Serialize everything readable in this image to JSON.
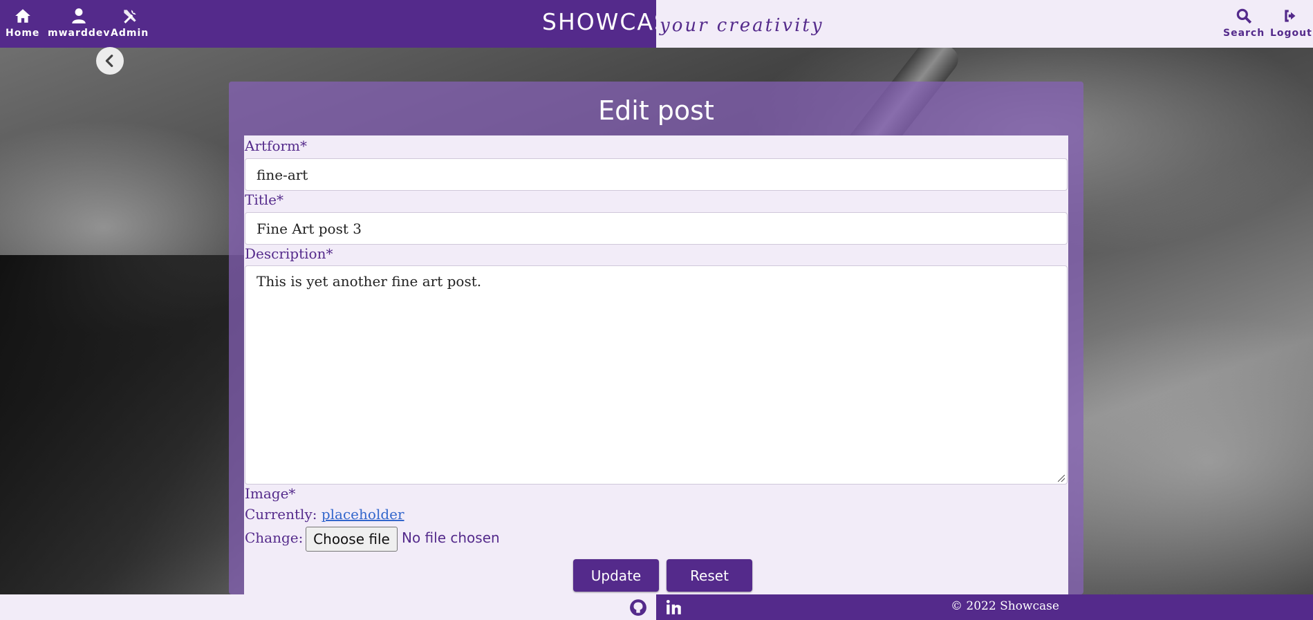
{
  "nav": {
    "left_items": [
      {
        "label": "Home",
        "icon": "home-icon"
      },
      {
        "label": "mwarddev",
        "icon": "user-icon"
      },
      {
        "label": "Admin",
        "icon": "tools-icon"
      }
    ],
    "brand": "SHOWCASE",
    "tagline": "your creativity",
    "right_items": [
      {
        "label": "Search",
        "icon": "search-icon"
      },
      {
        "label": "Logout",
        "icon": "logout-icon"
      }
    ]
  },
  "page": {
    "title": "Edit post",
    "back_icon": "chevron-left-icon"
  },
  "form": {
    "artform_label": "Artform*",
    "artform_value": "fine-art",
    "title_label": "Title*",
    "title_value": "Fine Art post 3",
    "description_label": "Description*",
    "description_value": "This is yet another fine art post.",
    "image_label": "Image*",
    "currently_label": "Currently:",
    "currently_link": "placeholder",
    "change_label": "Change:",
    "choose_file_label": "Choose file",
    "no_file_text": "No file chosen",
    "update_label": "Update",
    "reset_label": "Reset"
  },
  "footer": {
    "copyright": "© 2022 Showcase",
    "icons": [
      "github-icon",
      "linkedin-icon"
    ]
  },
  "colors": {
    "brand_purple": "#542a8b",
    "light_lavender": "#f2ecf8",
    "link_blue": "#3366cc"
  }
}
